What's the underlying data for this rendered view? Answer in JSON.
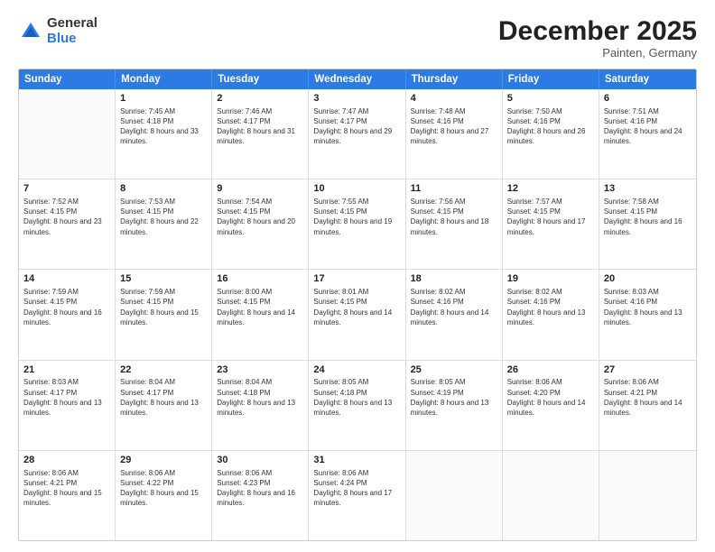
{
  "logo": {
    "general": "General",
    "blue": "Blue"
  },
  "header": {
    "month": "December 2025",
    "location": "Painten, Germany"
  },
  "weekdays": [
    "Sunday",
    "Monday",
    "Tuesday",
    "Wednesday",
    "Thursday",
    "Friday",
    "Saturday"
  ],
  "rows": [
    [
      {
        "day": "",
        "sunrise": "",
        "sunset": "",
        "daylight": ""
      },
      {
        "day": "1",
        "sunrise": "Sunrise: 7:45 AM",
        "sunset": "Sunset: 4:18 PM",
        "daylight": "Daylight: 8 hours and 33 minutes."
      },
      {
        "day": "2",
        "sunrise": "Sunrise: 7:46 AM",
        "sunset": "Sunset: 4:17 PM",
        "daylight": "Daylight: 8 hours and 31 minutes."
      },
      {
        "day": "3",
        "sunrise": "Sunrise: 7:47 AM",
        "sunset": "Sunset: 4:17 PM",
        "daylight": "Daylight: 8 hours and 29 minutes."
      },
      {
        "day": "4",
        "sunrise": "Sunrise: 7:48 AM",
        "sunset": "Sunset: 4:16 PM",
        "daylight": "Daylight: 8 hours and 27 minutes."
      },
      {
        "day": "5",
        "sunrise": "Sunrise: 7:50 AM",
        "sunset": "Sunset: 4:16 PM",
        "daylight": "Daylight: 8 hours and 26 minutes."
      },
      {
        "day": "6",
        "sunrise": "Sunrise: 7:51 AM",
        "sunset": "Sunset: 4:16 PM",
        "daylight": "Daylight: 8 hours and 24 minutes."
      }
    ],
    [
      {
        "day": "7",
        "sunrise": "Sunrise: 7:52 AM",
        "sunset": "Sunset: 4:15 PM",
        "daylight": "Daylight: 8 hours and 23 minutes."
      },
      {
        "day": "8",
        "sunrise": "Sunrise: 7:53 AM",
        "sunset": "Sunset: 4:15 PM",
        "daylight": "Daylight: 8 hours and 22 minutes."
      },
      {
        "day": "9",
        "sunrise": "Sunrise: 7:54 AM",
        "sunset": "Sunset: 4:15 PM",
        "daylight": "Daylight: 8 hours and 20 minutes."
      },
      {
        "day": "10",
        "sunrise": "Sunrise: 7:55 AM",
        "sunset": "Sunset: 4:15 PM",
        "daylight": "Daylight: 8 hours and 19 minutes."
      },
      {
        "day": "11",
        "sunrise": "Sunrise: 7:56 AM",
        "sunset": "Sunset: 4:15 PM",
        "daylight": "Daylight: 8 hours and 18 minutes."
      },
      {
        "day": "12",
        "sunrise": "Sunrise: 7:57 AM",
        "sunset": "Sunset: 4:15 PM",
        "daylight": "Daylight: 8 hours and 17 minutes."
      },
      {
        "day": "13",
        "sunrise": "Sunrise: 7:58 AM",
        "sunset": "Sunset: 4:15 PM",
        "daylight": "Daylight: 8 hours and 16 minutes."
      }
    ],
    [
      {
        "day": "14",
        "sunrise": "Sunrise: 7:59 AM",
        "sunset": "Sunset: 4:15 PM",
        "daylight": "Daylight: 8 hours and 16 minutes."
      },
      {
        "day": "15",
        "sunrise": "Sunrise: 7:59 AM",
        "sunset": "Sunset: 4:15 PM",
        "daylight": "Daylight: 8 hours and 15 minutes."
      },
      {
        "day": "16",
        "sunrise": "Sunrise: 8:00 AM",
        "sunset": "Sunset: 4:15 PM",
        "daylight": "Daylight: 8 hours and 14 minutes."
      },
      {
        "day": "17",
        "sunrise": "Sunrise: 8:01 AM",
        "sunset": "Sunset: 4:15 PM",
        "daylight": "Daylight: 8 hours and 14 minutes."
      },
      {
        "day": "18",
        "sunrise": "Sunrise: 8:02 AM",
        "sunset": "Sunset: 4:16 PM",
        "daylight": "Daylight: 8 hours and 14 minutes."
      },
      {
        "day": "19",
        "sunrise": "Sunrise: 8:02 AM",
        "sunset": "Sunset: 4:16 PM",
        "daylight": "Daylight: 8 hours and 13 minutes."
      },
      {
        "day": "20",
        "sunrise": "Sunrise: 8:03 AM",
        "sunset": "Sunset: 4:16 PM",
        "daylight": "Daylight: 8 hours and 13 minutes."
      }
    ],
    [
      {
        "day": "21",
        "sunrise": "Sunrise: 8:03 AM",
        "sunset": "Sunset: 4:17 PM",
        "daylight": "Daylight: 8 hours and 13 minutes."
      },
      {
        "day": "22",
        "sunrise": "Sunrise: 8:04 AM",
        "sunset": "Sunset: 4:17 PM",
        "daylight": "Daylight: 8 hours and 13 minutes."
      },
      {
        "day": "23",
        "sunrise": "Sunrise: 8:04 AM",
        "sunset": "Sunset: 4:18 PM",
        "daylight": "Daylight: 8 hours and 13 minutes."
      },
      {
        "day": "24",
        "sunrise": "Sunrise: 8:05 AM",
        "sunset": "Sunset: 4:18 PM",
        "daylight": "Daylight: 8 hours and 13 minutes."
      },
      {
        "day": "25",
        "sunrise": "Sunrise: 8:05 AM",
        "sunset": "Sunset: 4:19 PM",
        "daylight": "Daylight: 8 hours and 13 minutes."
      },
      {
        "day": "26",
        "sunrise": "Sunrise: 8:06 AM",
        "sunset": "Sunset: 4:20 PM",
        "daylight": "Daylight: 8 hours and 14 minutes."
      },
      {
        "day": "27",
        "sunrise": "Sunrise: 8:06 AM",
        "sunset": "Sunset: 4:21 PM",
        "daylight": "Daylight: 8 hours and 14 minutes."
      }
    ],
    [
      {
        "day": "28",
        "sunrise": "Sunrise: 8:06 AM",
        "sunset": "Sunset: 4:21 PM",
        "daylight": "Daylight: 8 hours and 15 minutes."
      },
      {
        "day": "29",
        "sunrise": "Sunrise: 8:06 AM",
        "sunset": "Sunset: 4:22 PM",
        "daylight": "Daylight: 8 hours and 15 minutes."
      },
      {
        "day": "30",
        "sunrise": "Sunrise: 8:06 AM",
        "sunset": "Sunset: 4:23 PM",
        "daylight": "Daylight: 8 hours and 16 minutes."
      },
      {
        "day": "31",
        "sunrise": "Sunrise: 8:06 AM",
        "sunset": "Sunset: 4:24 PM",
        "daylight": "Daylight: 8 hours and 17 minutes."
      },
      {
        "day": "",
        "sunrise": "",
        "sunset": "",
        "daylight": ""
      },
      {
        "day": "",
        "sunrise": "",
        "sunset": "",
        "daylight": ""
      },
      {
        "day": "",
        "sunrise": "",
        "sunset": "",
        "daylight": ""
      }
    ]
  ]
}
